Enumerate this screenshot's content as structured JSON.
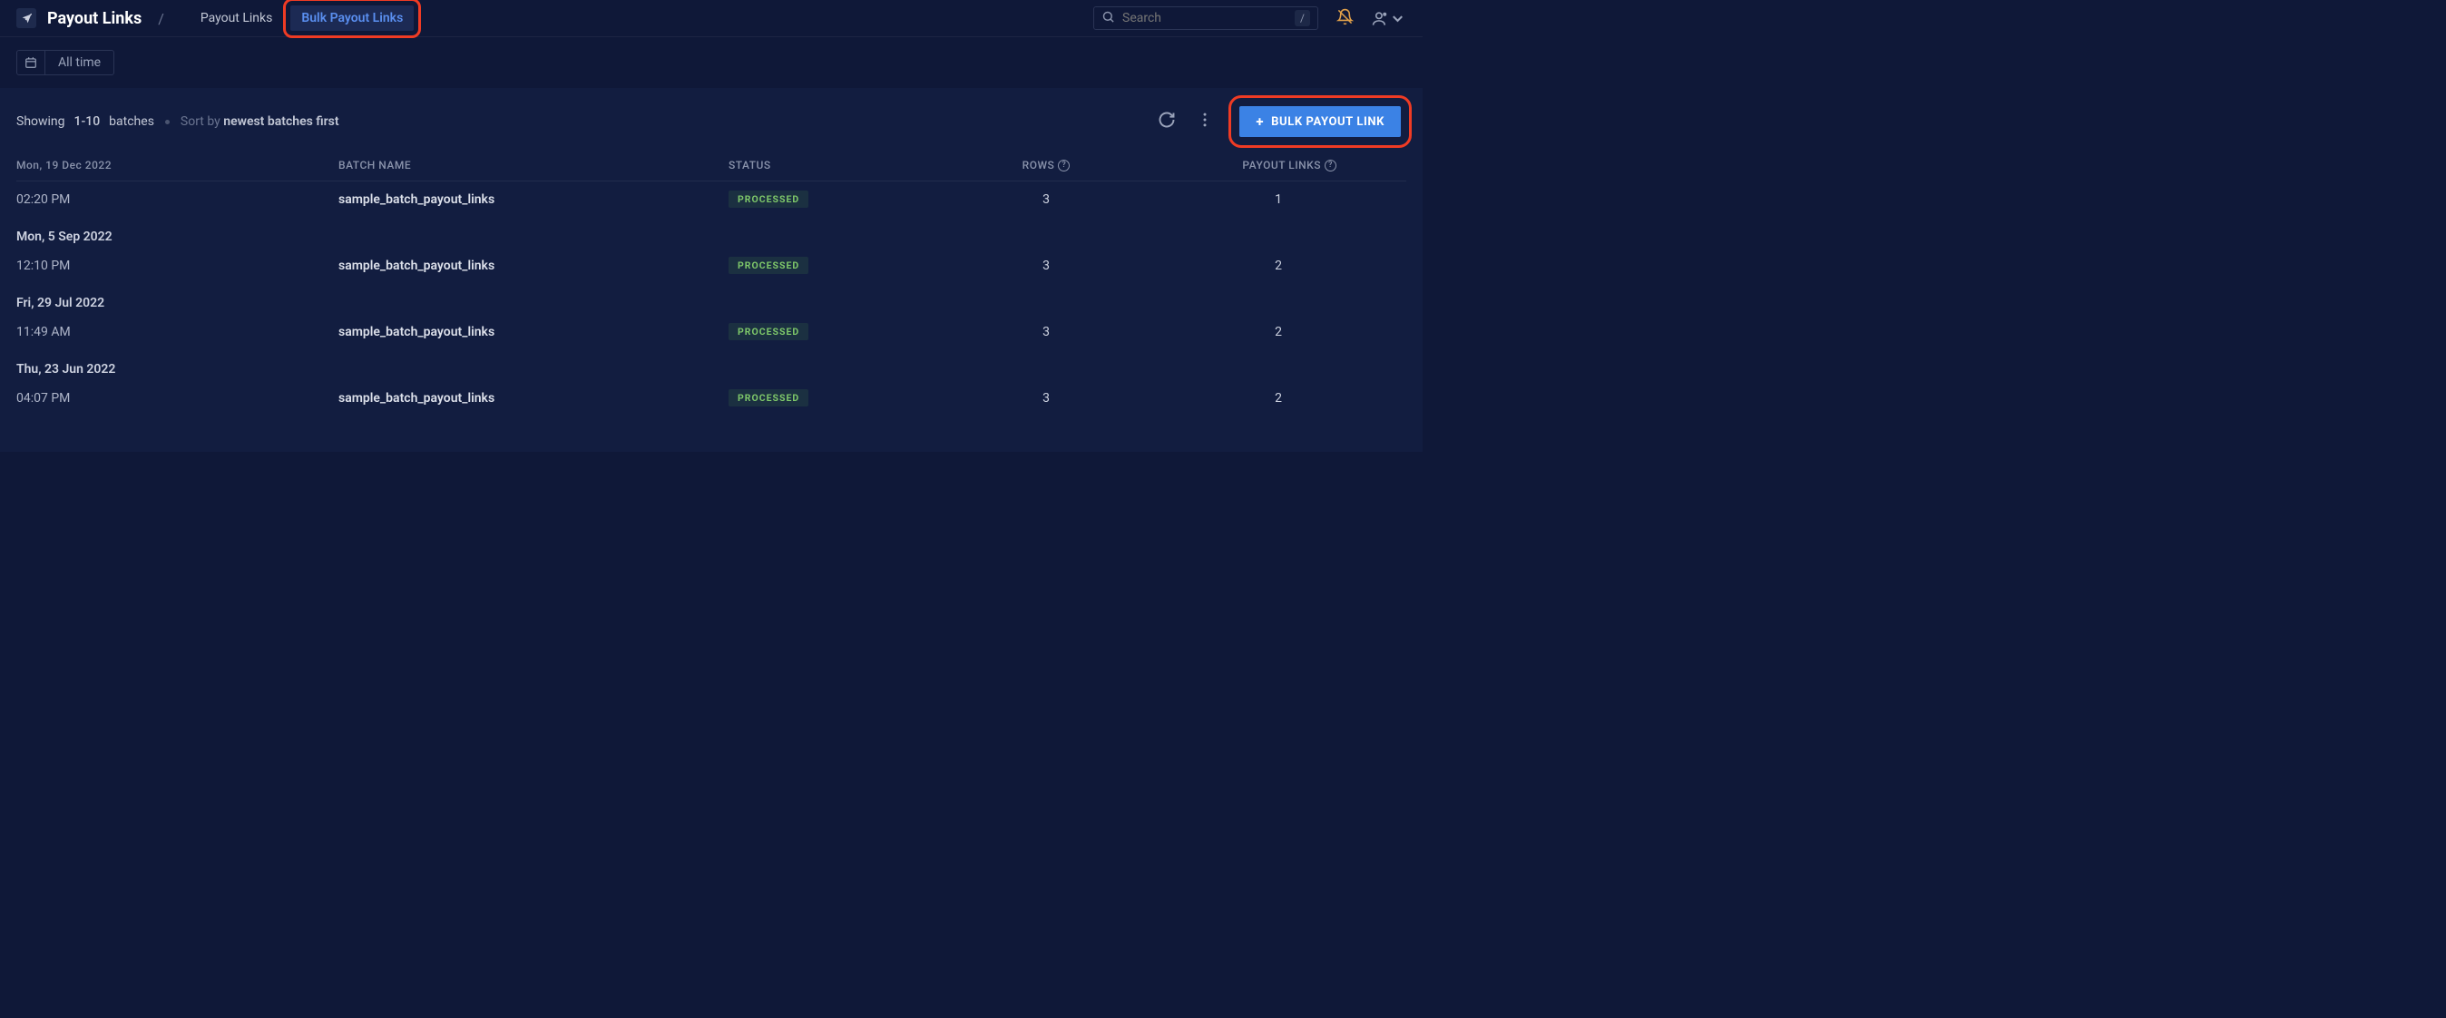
{
  "header": {
    "title": "Payout Links",
    "separator": "/",
    "tabs": [
      {
        "label": "Payout Links",
        "active": false
      },
      {
        "label": "Bulk Payout Links",
        "active": true
      }
    ],
    "search": {
      "placeholder": "Search",
      "shortcut": "/"
    }
  },
  "filters": {
    "date_label": "All time"
  },
  "toolbar": {
    "showing": "Showing",
    "range": "1-10",
    "batches": "batches",
    "sort_by": "Sort by ",
    "sort_value": "newest batches first",
    "primary_button": "BULK PAYOUT LINK"
  },
  "table": {
    "headers": {
      "batch_name": "BATCH NAME",
      "status": "STATUS",
      "rows": "ROWS",
      "payout_links": "PAYOUT LINKS"
    },
    "groups": [
      {
        "date": "Mon, 19 Dec 2022",
        "rows": [
          {
            "time": "02:20 PM",
            "name": "sample_batch_payout_links",
            "status": "PROCESSED",
            "rows": "3",
            "links": "1"
          }
        ]
      },
      {
        "date": "Mon, 5 Sep 2022",
        "rows": [
          {
            "time": "12:10 PM",
            "name": "sample_batch_payout_links",
            "status": "PROCESSED",
            "rows": "3",
            "links": "2"
          }
        ]
      },
      {
        "date": "Fri, 29 Jul 2022",
        "rows": [
          {
            "time": "11:49 AM",
            "name": "sample_batch_payout_links",
            "status": "PROCESSED",
            "rows": "3",
            "links": "2"
          }
        ]
      },
      {
        "date": "Thu, 23 Jun 2022",
        "rows": [
          {
            "time": "04:07 PM",
            "name": "sample_batch_payout_links",
            "status": "PROCESSED",
            "rows": "3",
            "links": "2"
          }
        ]
      }
    ]
  }
}
